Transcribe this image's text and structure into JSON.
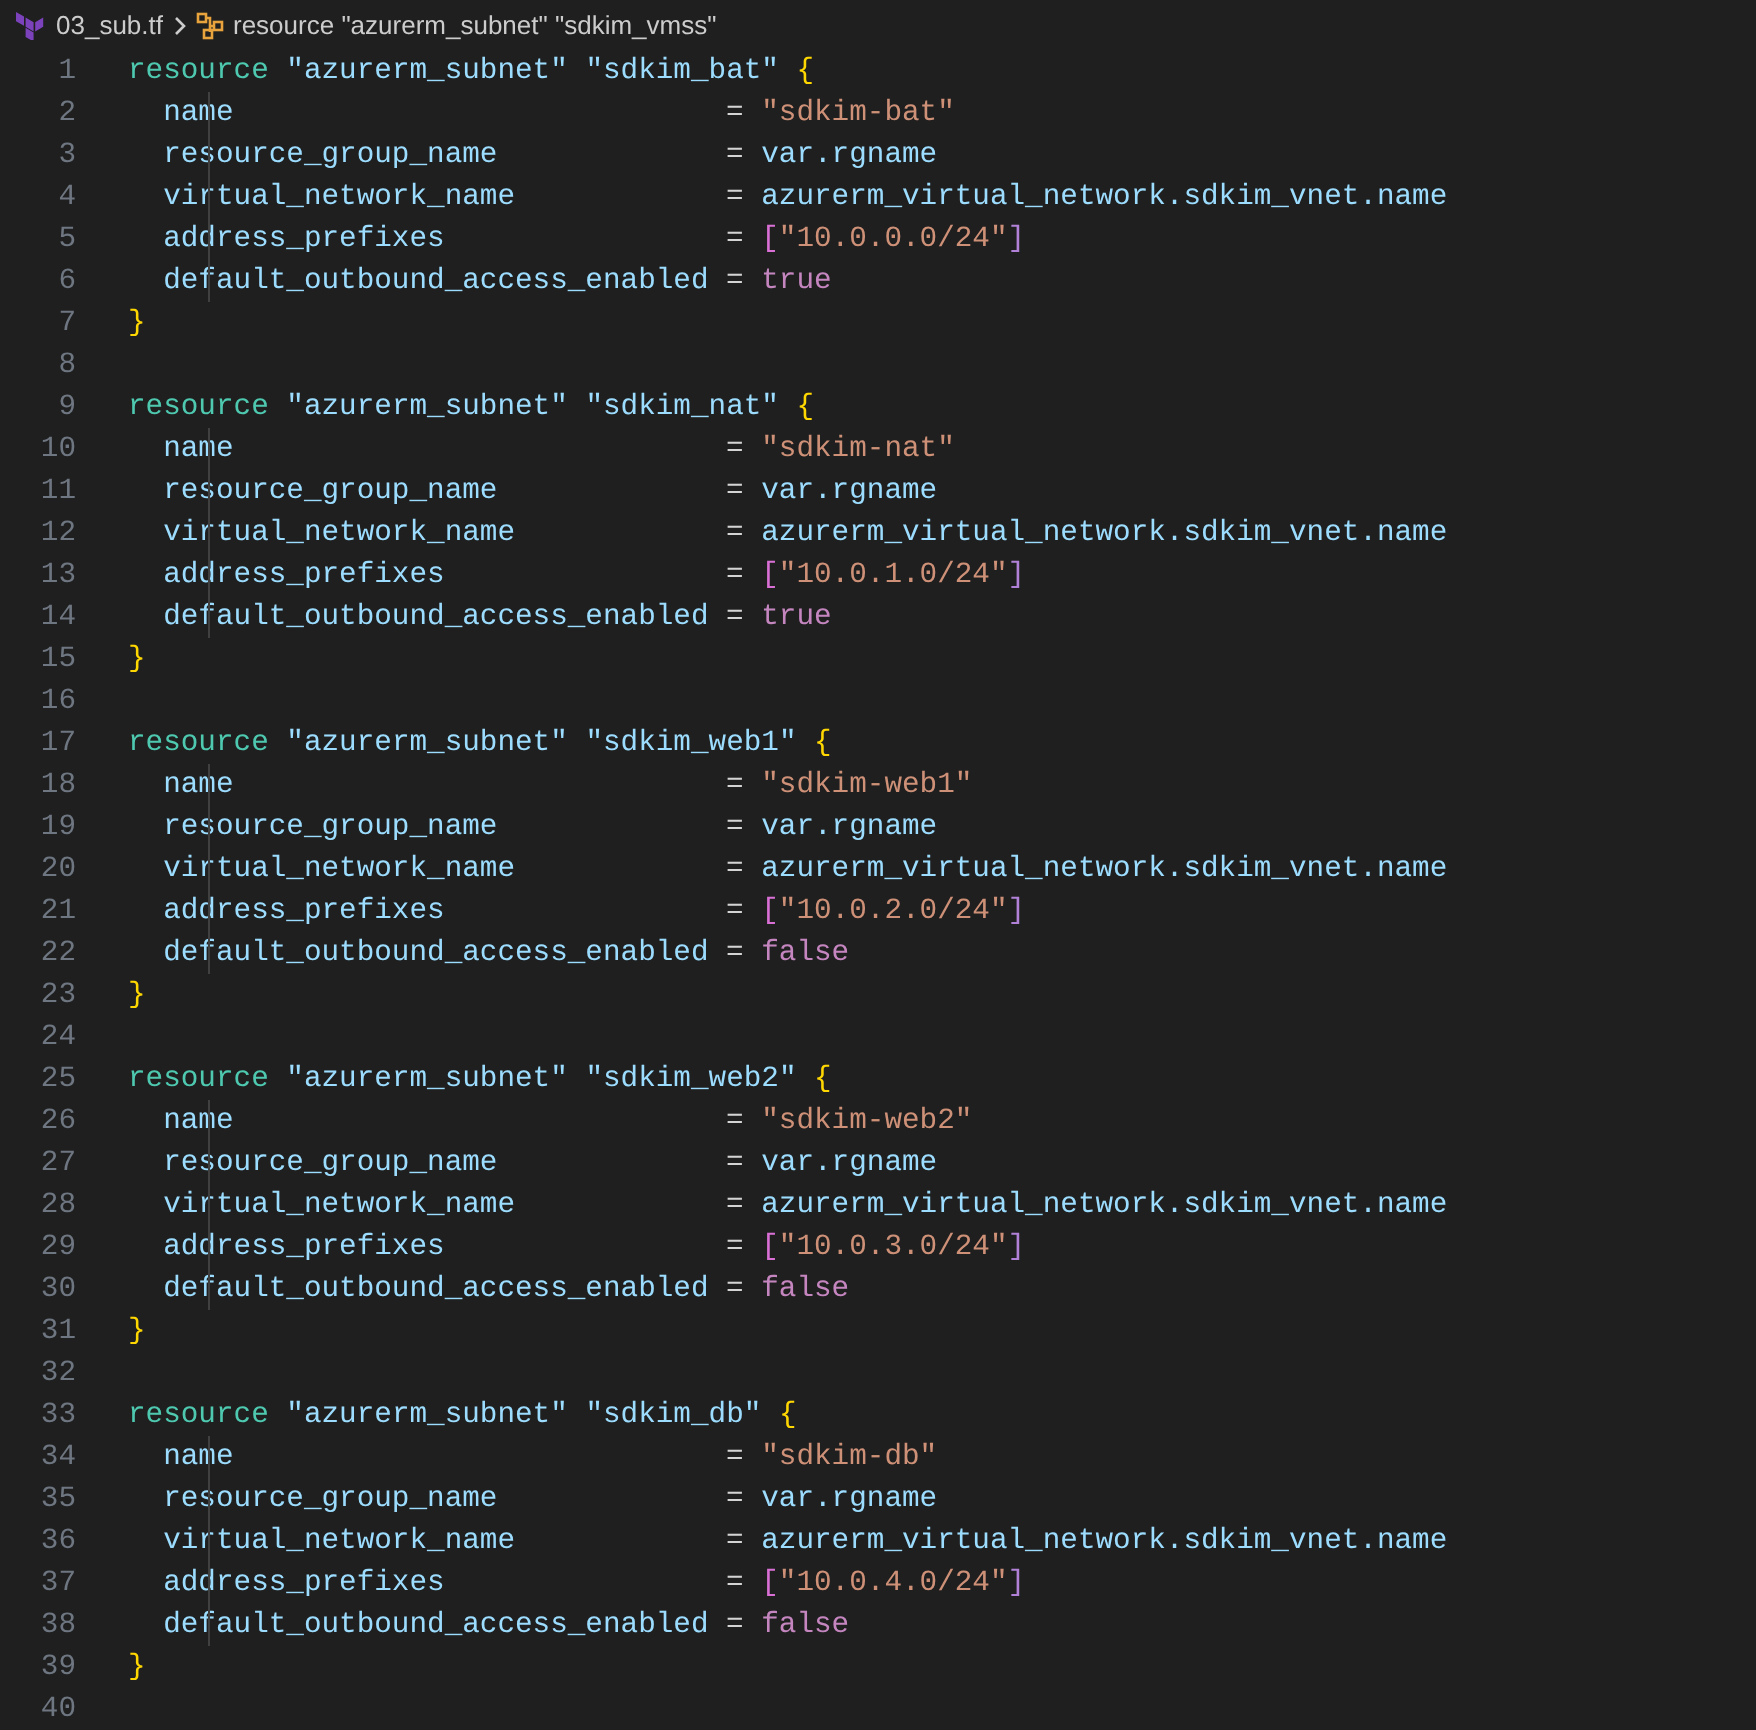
{
  "breadcrumb": {
    "file": "03_sub.tf",
    "symbol": "resource \"azurerm_subnet\" \"sdkim_vmss\""
  },
  "lines": [
    {
      "number": "1",
      "kind": "open",
      "keyword": "resource",
      "type": "\"azurerm_subnet\"",
      "label": "\"sdkim_bat\"",
      "brace": "{"
    },
    {
      "number": "2",
      "kind": "attr",
      "key": "name",
      "op": "=",
      "value": [
        {
          "text": "\"sdkim-bat\"",
          "kind": "string"
        }
      ]
    },
    {
      "number": "3",
      "kind": "attr",
      "key": "resource_group_name",
      "op": "=",
      "value": [
        {
          "text": "var.rgname",
          "kind": "ref"
        }
      ]
    },
    {
      "number": "4",
      "kind": "attr",
      "key": "virtual_network_name",
      "op": "=",
      "value": [
        {
          "text": "azurerm_virtual_network.sdkim_vnet.name",
          "kind": "ref"
        }
      ]
    },
    {
      "number": "5",
      "kind": "attr",
      "key": "address_prefixes",
      "op": "=",
      "value": [
        {
          "text": "[",
          "kind": "bracket"
        },
        {
          "text": "\"10.0.0.0/24\"",
          "kind": "string"
        },
        {
          "text": "]",
          "kind": "bracket_close"
        }
      ]
    },
    {
      "number": "6",
      "kind": "attr",
      "key": "default_outbound_access_enabled",
      "op": "=",
      "value": [
        {
          "text": "true",
          "kind": "bool"
        }
      ]
    },
    {
      "number": "7",
      "kind": "close",
      "brace": "}"
    },
    {
      "number": "8",
      "kind": "blank"
    },
    {
      "number": "9",
      "kind": "open",
      "keyword": "resource",
      "type": "\"azurerm_subnet\"",
      "label": "\"sdkim_nat\"",
      "brace": "{"
    },
    {
      "number": "10",
      "kind": "attr",
      "key": "name",
      "op": "=",
      "value": [
        {
          "text": "\"sdkim-nat\"",
          "kind": "string"
        }
      ]
    },
    {
      "number": "11",
      "kind": "attr",
      "key": "resource_group_name",
      "op": "=",
      "value": [
        {
          "text": "var.rgname",
          "kind": "ref"
        }
      ]
    },
    {
      "number": "12",
      "kind": "attr",
      "key": "virtual_network_name",
      "op": "=",
      "value": [
        {
          "text": "azurerm_virtual_network.sdkim_vnet.name",
          "kind": "ref"
        }
      ]
    },
    {
      "number": "13",
      "kind": "attr",
      "key": "address_prefixes",
      "op": "=",
      "value": [
        {
          "text": "[",
          "kind": "bracket"
        },
        {
          "text": "\"10.0.1.0/24\"",
          "kind": "string"
        },
        {
          "text": "]",
          "kind": "bracket_close"
        }
      ]
    },
    {
      "number": "14",
      "kind": "attr",
      "key": "default_outbound_access_enabled",
      "op": "=",
      "value": [
        {
          "text": "true",
          "kind": "bool"
        }
      ]
    },
    {
      "number": "15",
      "kind": "close",
      "brace": "}"
    },
    {
      "number": "16",
      "kind": "blank"
    },
    {
      "number": "17",
      "kind": "open",
      "keyword": "resource",
      "type": "\"azurerm_subnet\"",
      "label": "\"sdkim_web1\"",
      "brace": "{"
    },
    {
      "number": "18",
      "kind": "attr",
      "key": "name",
      "op": "=",
      "value": [
        {
          "text": "\"sdkim-web1\"",
          "kind": "string"
        }
      ]
    },
    {
      "number": "19",
      "kind": "attr",
      "key": "resource_group_name",
      "op": "=",
      "value": [
        {
          "text": "var.rgname",
          "kind": "ref"
        }
      ]
    },
    {
      "number": "20",
      "kind": "attr",
      "key": "virtual_network_name",
      "op": "=",
      "value": [
        {
          "text": "azurerm_virtual_network.sdkim_vnet.name",
          "kind": "ref"
        }
      ]
    },
    {
      "number": "21",
      "kind": "attr",
      "key": "address_prefixes",
      "op": "=",
      "value": [
        {
          "text": "[",
          "kind": "bracket"
        },
        {
          "text": "\"10.0.2.0/24\"",
          "kind": "string"
        },
        {
          "text": "]",
          "kind": "bracket_close"
        }
      ]
    },
    {
      "number": "22",
      "kind": "attr",
      "key": "default_outbound_access_enabled",
      "op": "=",
      "value": [
        {
          "text": "false",
          "kind": "bool"
        }
      ]
    },
    {
      "number": "23",
      "kind": "close",
      "brace": "}"
    },
    {
      "number": "24",
      "kind": "blank"
    },
    {
      "number": "25",
      "kind": "open",
      "keyword": "resource",
      "type": "\"azurerm_subnet\"",
      "label": "\"sdkim_web2\"",
      "brace": "{"
    },
    {
      "number": "26",
      "kind": "attr",
      "key": "name",
      "op": "=",
      "value": [
        {
          "text": "\"sdkim-web2\"",
          "kind": "string"
        }
      ]
    },
    {
      "number": "27",
      "kind": "attr",
      "key": "resource_group_name",
      "op": "=",
      "value": [
        {
          "text": "var.rgname",
          "kind": "ref"
        }
      ]
    },
    {
      "number": "28",
      "kind": "attr",
      "key": "virtual_network_name",
      "op": "=",
      "value": [
        {
          "text": "azurerm_virtual_network.sdkim_vnet.name",
          "kind": "ref"
        }
      ]
    },
    {
      "number": "29",
      "kind": "attr",
      "key": "address_prefixes",
      "op": "=",
      "value": [
        {
          "text": "[",
          "kind": "bracket"
        },
        {
          "text": "\"10.0.3.0/24\"",
          "kind": "string"
        },
        {
          "text": "]",
          "kind": "bracket_close"
        }
      ]
    },
    {
      "number": "30",
      "kind": "attr",
      "key": "default_outbound_access_enabled",
      "op": "=",
      "value": [
        {
          "text": "false",
          "kind": "bool"
        }
      ]
    },
    {
      "number": "31",
      "kind": "close",
      "brace": "}"
    },
    {
      "number": "32",
      "kind": "blank"
    },
    {
      "number": "33",
      "kind": "open",
      "keyword": "resource",
      "type": "\"azurerm_subnet\"",
      "label": "\"sdkim_db\"",
      "brace": "{"
    },
    {
      "number": "34",
      "kind": "attr",
      "key": "name",
      "op": "=",
      "value": [
        {
          "text": "\"sdkim-db\"",
          "kind": "string"
        }
      ]
    },
    {
      "number": "35",
      "kind": "attr",
      "key": "resource_group_name",
      "op": "=",
      "value": [
        {
          "text": "var.rgname",
          "kind": "ref"
        }
      ]
    },
    {
      "number": "36",
      "kind": "attr",
      "key": "virtual_network_name",
      "op": "=",
      "value": [
        {
          "text": "azurerm_virtual_network.sdkim_vnet.name",
          "kind": "ref"
        }
      ]
    },
    {
      "number": "37",
      "kind": "attr",
      "key": "address_prefixes",
      "op": "=",
      "value": [
        {
          "text": "[",
          "kind": "bracket"
        },
        {
          "text": "\"10.0.4.0/24\"",
          "kind": "string"
        },
        {
          "text": "]",
          "kind": "bracket_close"
        }
      ]
    },
    {
      "number": "38",
      "kind": "attr",
      "key": "default_outbound_access_enabled",
      "op": "=",
      "value": [
        {
          "text": "false",
          "kind": "bool"
        }
      ]
    },
    {
      "number": "39",
      "kind": "close",
      "brace": "}"
    },
    {
      "number": "40",
      "kind": "blank"
    }
  ]
}
